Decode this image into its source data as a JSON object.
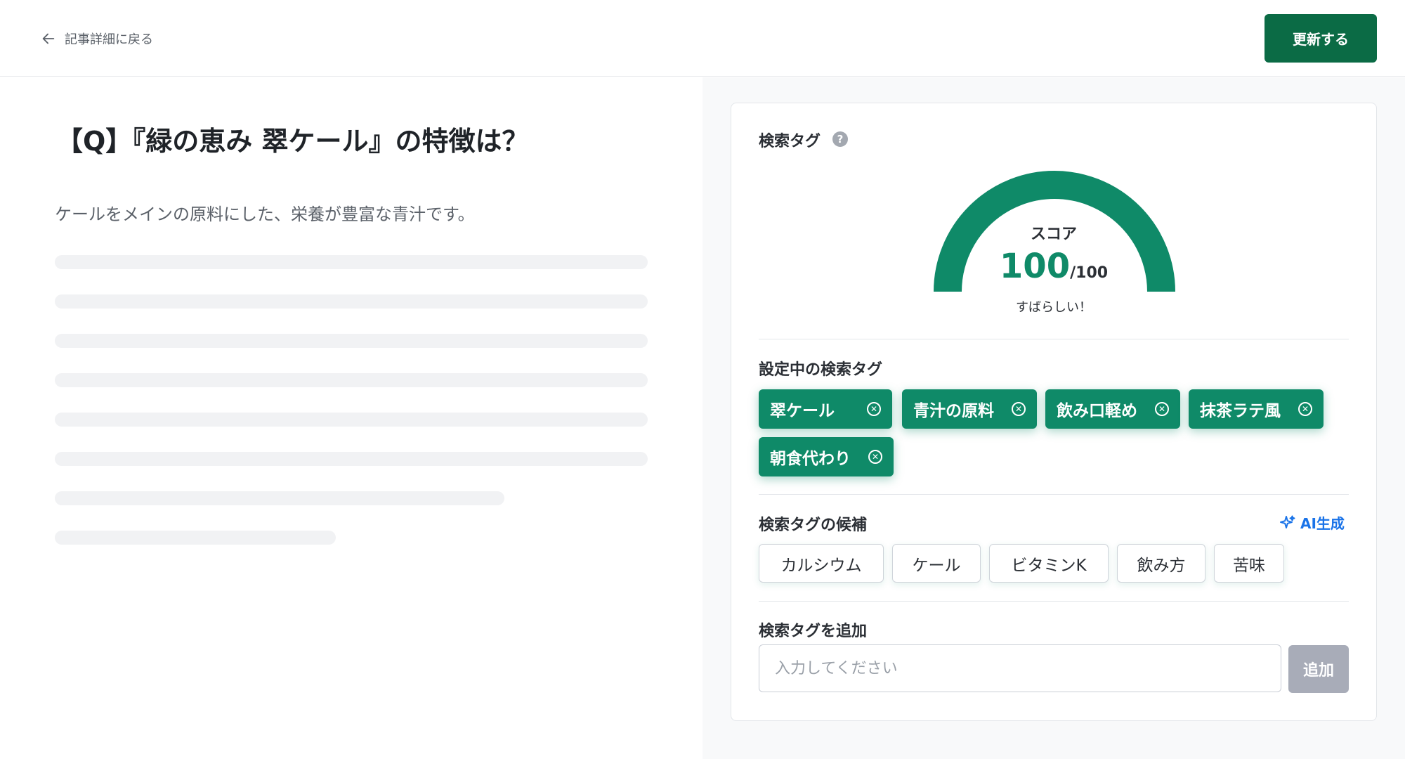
{
  "header": {
    "back_label": "記事詳細に戻る",
    "update_label": "更新する"
  },
  "article": {
    "title": "【Q】『緑の恵み 翠ケール』の特徴は？",
    "description": "ケールをメインの原料にした、栄養が豊富な青汁です。"
  },
  "panel": {
    "title": "検索タグ",
    "help_glyph": "?",
    "score": {
      "label": "スコア",
      "value": "100",
      "max": "/100",
      "fraction": 1.0,
      "message": "すばらしい！"
    },
    "active_tags_label": "設定中の検索タグ",
    "active_tags": [
      "翠ケール",
      "青汁の原料",
      "飲み口軽め",
      "抹茶ラテ風",
      "朝食代わり"
    ],
    "candidates_label": "検索タグの候補",
    "ai_label": "AI生成",
    "candidates": [
      "カルシウム",
      "ケール",
      "ビタミンK",
      "飲み方",
      "苦味"
    ],
    "add_label": "検索タグを追加",
    "input_placeholder": "入力してください",
    "input_value": "",
    "add_button": "追加"
  },
  "colors": {
    "primary": "#0f8a68",
    "update_button": "#0b6b45",
    "ai_blue": "#1a73e8",
    "disabled_button": "#a8acb8"
  },
  "icons": {
    "back": "arrow-left-icon",
    "help": "question-circle-icon",
    "remove": "close-circle-icon",
    "ai": "sparkle-icon"
  }
}
